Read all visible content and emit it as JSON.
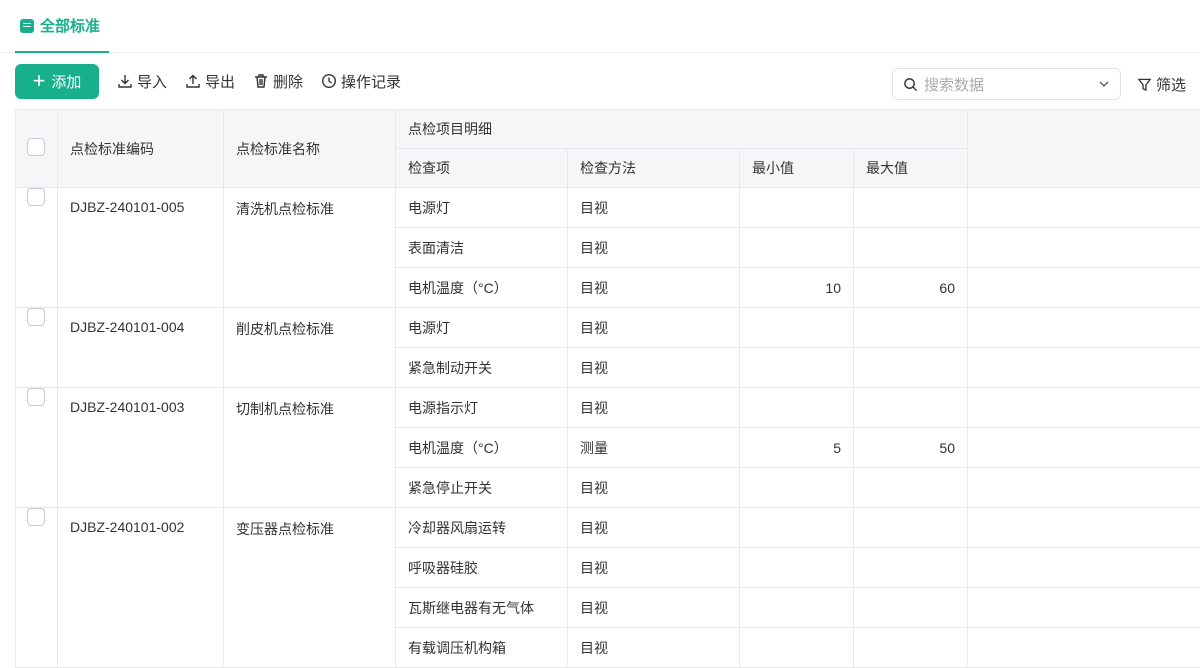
{
  "tab": {
    "label": "全部标准"
  },
  "toolbar": {
    "add": "添加",
    "import": "导入",
    "export": "导出",
    "delete": "删除",
    "log": "操作记录",
    "search_placeholder": "搜索数据",
    "filter": "筛选"
  },
  "columns": {
    "code": "点检标准编码",
    "name": "点检标准名称",
    "detail": "点检项目明细",
    "item": "检查项",
    "method": "检查方法",
    "min": "最小值",
    "max": "最大值"
  },
  "rows": [
    {
      "code": "DJBZ-240101-005",
      "name": "清洗机点检标准",
      "items": [
        [
          "电源灯",
          "目视",
          "",
          ""
        ],
        [
          "表面清洁",
          "目视",
          "",
          ""
        ],
        [
          "电机温度（°C）",
          "目视",
          "10",
          "60"
        ]
      ]
    },
    {
      "code": "DJBZ-240101-004",
      "name": "削皮机点检标准",
      "items": [
        [
          "电源灯",
          "目视",
          "",
          ""
        ],
        [
          "紧急制动开关",
          "目视",
          "",
          ""
        ]
      ]
    },
    {
      "code": "DJBZ-240101-003",
      "name": "切制机点检标准",
      "items": [
        [
          "电源指示灯",
          "目视",
          "",
          ""
        ],
        [
          "电机温度（°C）",
          "测量",
          "5",
          "50"
        ],
        [
          "紧急停止开关",
          "目视",
          "",
          ""
        ]
      ]
    },
    {
      "code": "DJBZ-240101-002",
      "name": "变压器点检标准",
      "items": [
        [
          "冷却器风扇运转",
          "目视",
          "",
          ""
        ],
        [
          "呼吸器硅胶",
          "目视",
          "",
          ""
        ],
        [
          "瓦斯继电器有无气体",
          "目视",
          "",
          ""
        ],
        [
          "有载调压机构箱",
          "目视",
          "",
          ""
        ]
      ]
    }
  ]
}
